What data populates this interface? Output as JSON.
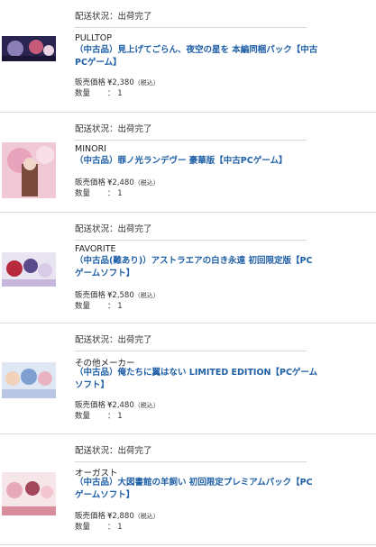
{
  "status_label": "配送状況：出荷完了",
  "labels": {
    "price": "販売価格 ：",
    "qty": "数量",
    "qty_sep": "："
  },
  "items": [
    {
      "maker": "PULLTOP",
      "title": "（中古品）見上げてごらん、夜空の星を 本編同梱パック【中古PCゲーム】",
      "price": "¥2,380",
      "tax": "（税込）",
      "qty": "1"
    },
    {
      "maker": "MINORI",
      "title": "（中古品）罪ノ光ランデヴー 豪華版【中古PCゲーム】",
      "price": "¥2,480",
      "tax": "（税込）",
      "qty": "1"
    },
    {
      "maker": "FAVORITE",
      "title": "（中古品(難あり)）アストラエアの白き永遠 初回限定版【PCゲームソフト】",
      "price": "¥2,580",
      "tax": "（税込）",
      "qty": "1"
    },
    {
      "maker": "その他メーカー",
      "title": "（中古品）俺たちに翼はない LIMITED EDITION【PCゲームソフト】",
      "price": "¥2,480",
      "tax": "（税込）",
      "qty": "1"
    },
    {
      "maker": "オーガスト",
      "title": "（中古品）大図書館の羊飼い 初回限定プレミアムパック【PCゲームソフト】",
      "price": "¥2,880",
      "tax": "（税込）",
      "qty": "1"
    }
  ]
}
